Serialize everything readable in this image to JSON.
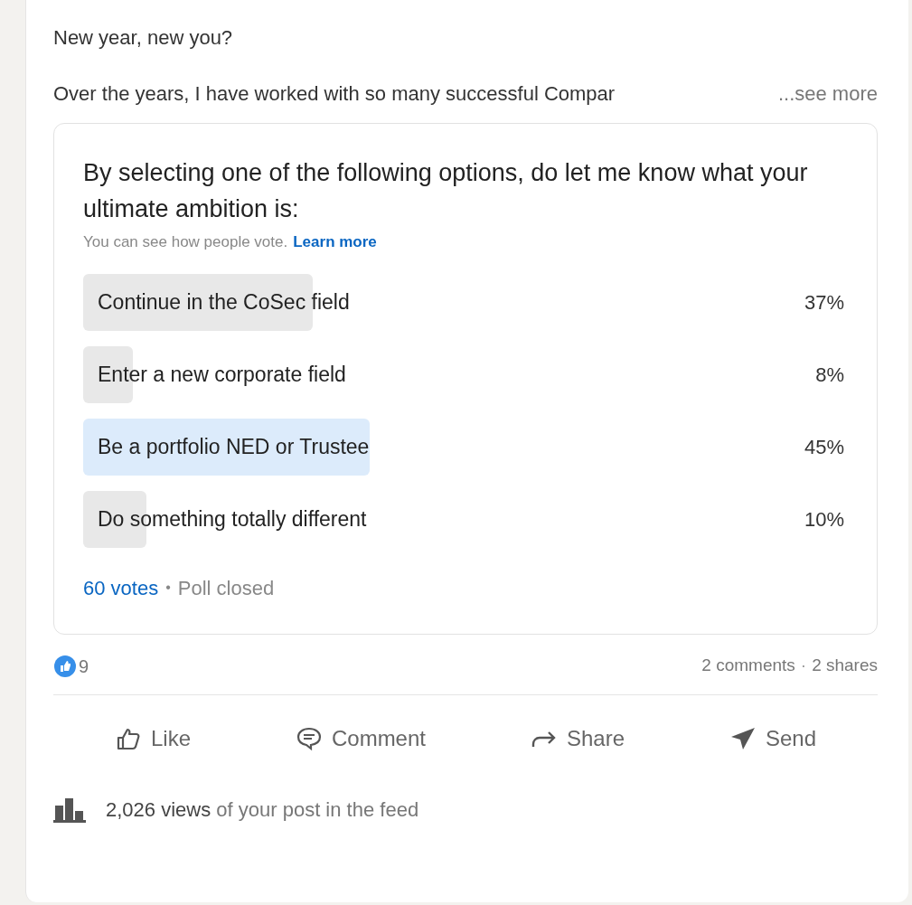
{
  "post": {
    "headline": "New year, new you?",
    "body": "Over the years, I have worked with so many successful Compar",
    "see_more": "...see more"
  },
  "poll": {
    "question": "By selecting one of the following options, do let me know what your ultimate ambition is:",
    "note": "You can see how people vote.",
    "learn_more": "Learn more",
    "options": [
      {
        "label": "Continue in the CoSec field",
        "percent": "37%",
        "level": 0.3,
        "selected": false
      },
      {
        "label": "Enter a new corporate field",
        "percent": "8%",
        "level": 0.065,
        "selected": false
      },
      {
        "label": "Be a portfolio NED or Trustee",
        "percent": "45%",
        "level": 0.375,
        "selected": true
      },
      {
        "label": "Do something totally different",
        "percent": "10%",
        "level": 0.083,
        "selected": false
      }
    ],
    "votes": "60 votes",
    "separator": "•",
    "status": "Poll closed"
  },
  "social": {
    "reactions": "9",
    "comments": "2 comments",
    "separator": "·",
    "shares": "2 shares"
  },
  "actions": [
    {
      "kind": "like",
      "label": "Like"
    },
    {
      "kind": "comment",
      "label": "Comment"
    },
    {
      "kind": "share",
      "label": "Share"
    },
    {
      "kind": "send",
      "label": "Send"
    }
  ],
  "views": "**2,026 views** of your post in the feed"
}
